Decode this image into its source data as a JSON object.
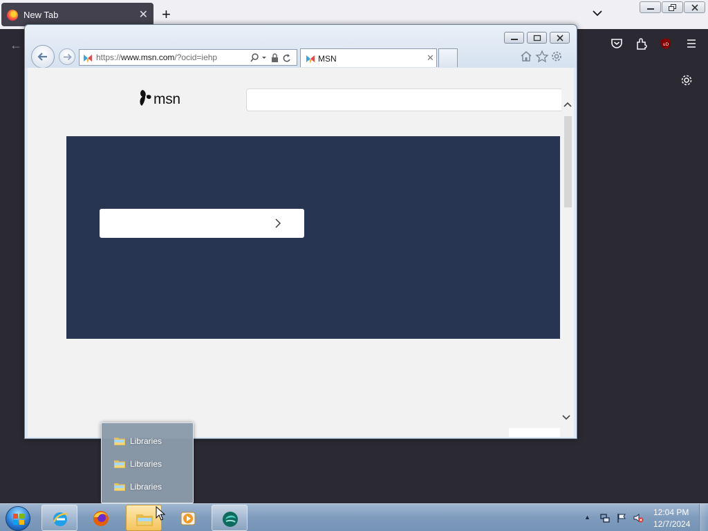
{
  "firefox": {
    "tab_title": "New Tab",
    "icons": [
      "firefox-icon",
      "close-icon",
      "plus-icon",
      "chevron-down-icon",
      "back-arrow-icon",
      "pocket-icon",
      "extensions-icon",
      "ublock-icon",
      "hamburger-menu-icon",
      "gear-icon"
    ],
    "ublock_badge": "uD"
  },
  "ie": {
    "url_protocol": "https://",
    "url_host": "www.msn.com",
    "url_path": "/?ocid=iehp",
    "tab_title": "MSN",
    "icons": [
      "back-icon",
      "forward-icon",
      "search-icon",
      "dropdown-icon",
      "lock-icon",
      "refresh-icon",
      "home-icon",
      "star-icon",
      "gear-icon"
    ]
  },
  "msn": {
    "logo_text": "msn",
    "search_placeholder": "",
    "hero_color": "#283552"
  },
  "jumplist": {
    "items": [
      {
        "label": "Libraries"
      },
      {
        "label": "Libraries"
      },
      {
        "label": "Libraries"
      }
    ]
  },
  "taskbar": {
    "pinned": [
      "start-orb",
      "internet-explorer",
      "firefox",
      "windows-explorer",
      "media-player",
      "app"
    ],
    "time": "12:04 PM",
    "date": "12/7/2024"
  }
}
